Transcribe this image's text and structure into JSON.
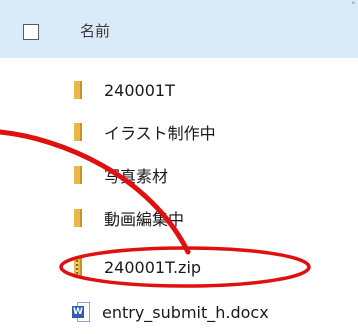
{
  "header": {
    "column_name": "名前"
  },
  "files": [
    {
      "name": "240001T",
      "icon": "folder-icon"
    },
    {
      "name": "イラスト制作中",
      "icon": "folder-icon"
    },
    {
      "name": "写真素材",
      "icon": "folder-icon"
    },
    {
      "name": "動画編集中",
      "icon": "folder-icon"
    },
    {
      "name": "240001T.zip",
      "icon": "zip-folder-icon"
    },
    {
      "name": "entry_submit_h.docx",
      "icon": "word-document-icon"
    }
  ],
  "annotation": {
    "color": "#e01010"
  },
  "colors": {
    "header_bg": "#d9ebf9",
    "folder": "#e8b94a",
    "word": "#2b5fad"
  }
}
